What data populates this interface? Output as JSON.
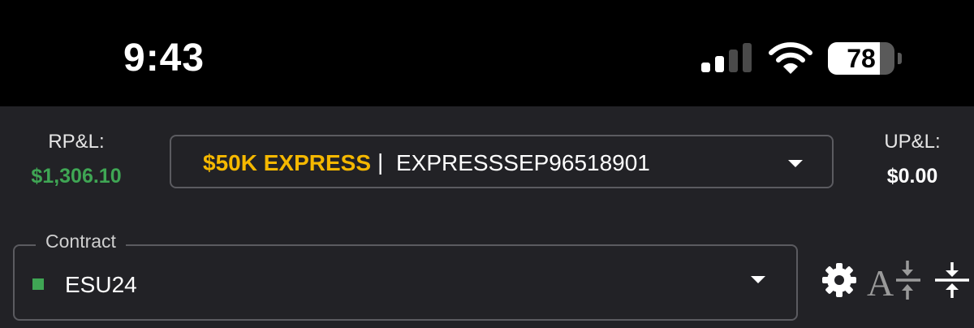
{
  "status_bar": {
    "time": "9:43",
    "battery_level": "78",
    "battery_fraction": 0.78,
    "signal_bars_active": 2,
    "signal_bars_total": 4,
    "icons": [
      "cellular-signal-icon",
      "wifi-icon",
      "battery-icon"
    ]
  },
  "pnl": {
    "realized_label": "RP&L:",
    "realized_value": "$1,306.10",
    "unrealized_label": "UP&L:",
    "unrealized_value": "$0.00"
  },
  "account": {
    "name": "$50K EXPRESS",
    "separator": "|",
    "id": "EXPRESSSEP96518901"
  },
  "contract": {
    "legend": "Contract",
    "value": "ESU24"
  },
  "toolbar": {
    "icons": [
      "gear-icon",
      "font-size-compress-icon",
      "row-compress-icon"
    ]
  },
  "colors": {
    "background": "#000000",
    "panel": "#222226",
    "positive": "#3fa654",
    "accent": "#f5b800",
    "border": "#5b5b60",
    "icon": "#ffffff",
    "icon_muted": "#9a9a9a"
  }
}
